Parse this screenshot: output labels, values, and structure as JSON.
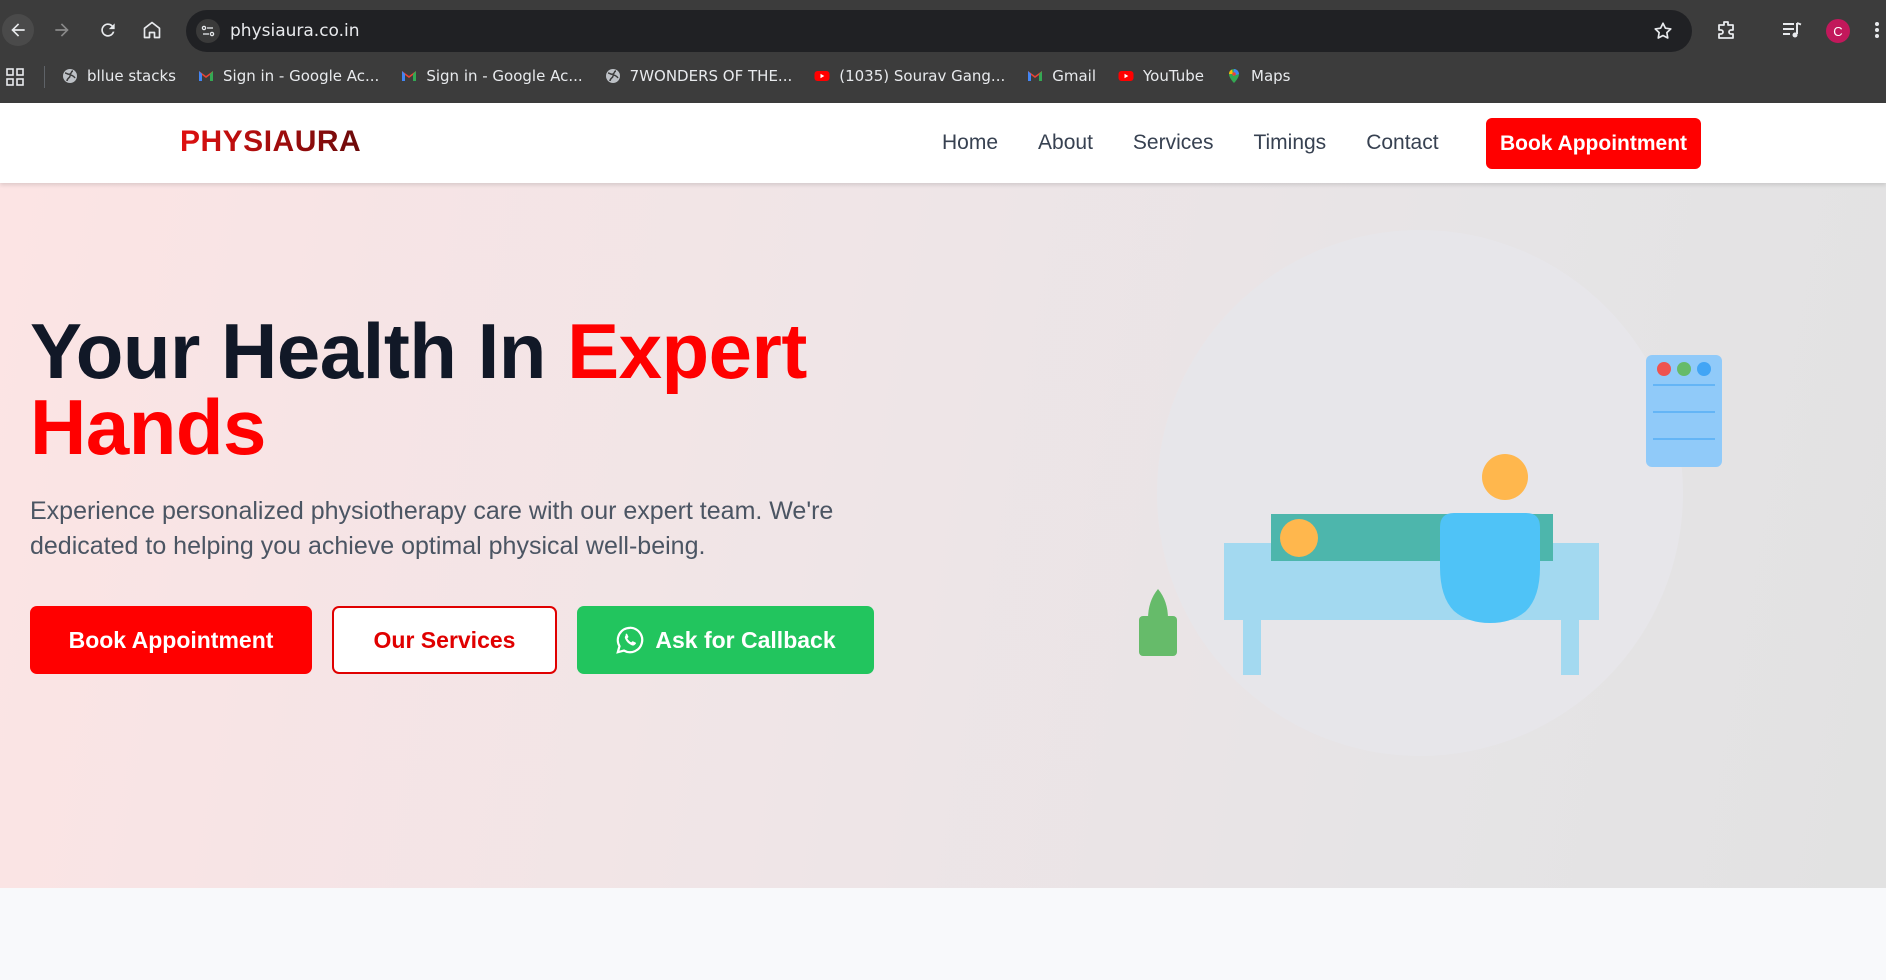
{
  "browser": {
    "url": "physiaura.co.in",
    "profile_initial": "C",
    "bookmarks": [
      {
        "label": "bllue stacks",
        "icon": "globe-icon"
      },
      {
        "label": "Sign in - Google Ac...",
        "icon": "gmail-icon"
      },
      {
        "label": "Sign in - Google Ac...",
        "icon": "gmail-icon"
      },
      {
        "label": "7WONDERS OF THE...",
        "icon": "globe-icon"
      },
      {
        "label": "(1035) Sourav Gang...",
        "icon": "youtube-icon"
      },
      {
        "label": "Gmail",
        "icon": "gmail-icon"
      },
      {
        "label": "YouTube",
        "icon": "youtube-icon"
      },
      {
        "label": "Maps",
        "icon": "maps-icon"
      }
    ]
  },
  "header": {
    "logo": "PHYSIAURA",
    "nav": [
      "Home",
      "About",
      "Services",
      "Timings",
      "Contact"
    ],
    "cta": "Book Appointment"
  },
  "hero": {
    "headline_part1": "Your Health In ",
    "headline_highlight": "Expert Hands",
    "subtext": "Experience personalized physiotherapy care with our expert team. We're dedicated to helping you achieve optimal physical well-being.",
    "buttons": {
      "book": "Book Appointment",
      "services": "Our Services",
      "callback": "Ask for Callback"
    }
  },
  "colors": {
    "brand_red": "#ff0000",
    "whatsapp_green": "#22c55e",
    "heading_dark": "#111827"
  }
}
